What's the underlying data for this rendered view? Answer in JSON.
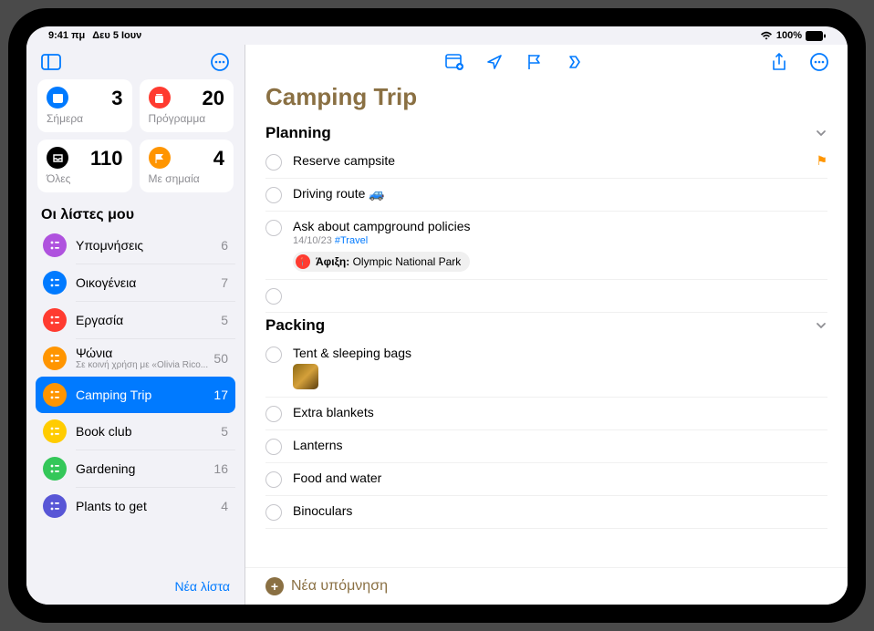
{
  "status": {
    "time": "9:41 πμ",
    "date": "Δευ 5 Ιουν",
    "battery": "100%"
  },
  "smartLists": [
    {
      "label": "Σήμερα",
      "count": "3",
      "color": "#007aff",
      "icon": "calendar"
    },
    {
      "label": "Πρόγραμμα",
      "count": "20",
      "color": "#ff3b30",
      "icon": "calendar-stack"
    },
    {
      "label": "Όλες",
      "count": "110",
      "color": "#000",
      "icon": "tray"
    },
    {
      "label": "Με σημαία",
      "count": "4",
      "color": "#ff9500",
      "icon": "flag"
    }
  ],
  "myListsHeader": "Οι λίστες μου",
  "lists": [
    {
      "name": "Υπομνήσεις",
      "count": "6",
      "color": "#af52de",
      "sub": ""
    },
    {
      "name": "Οικογένεια",
      "count": "7",
      "color": "#007aff",
      "sub": ""
    },
    {
      "name": "Εργασία",
      "count": "5",
      "color": "#ff3b30",
      "sub": ""
    },
    {
      "name": "Ψώνια",
      "count": "50",
      "color": "#ff9500",
      "sub": "Σε κοινή χρήση με «Olivia Rico..."
    },
    {
      "name": "Camping Trip",
      "count": "17",
      "color": "#ff9500",
      "sub": "",
      "selected": true
    },
    {
      "name": "Book club",
      "count": "5",
      "color": "#ffcc00",
      "sub": ""
    },
    {
      "name": "Gardening",
      "count": "16",
      "color": "#34c759",
      "sub": ""
    },
    {
      "name": "Plants to get",
      "count": "4",
      "color": "#5856d6",
      "sub": ""
    }
  ],
  "newListLabel": "Νέα λίστα",
  "main": {
    "title": "Camping Trip",
    "titleColor": "#8a7043",
    "sections": [
      {
        "name": "Planning",
        "items": [
          {
            "title": "Reserve campsite",
            "flagged": true
          },
          {
            "title": "Driving route 🚙"
          },
          {
            "title": "Ask about campground policies",
            "date": "14/10/23",
            "tag": "#Travel",
            "locationLabel": "Άφιξη:",
            "locationPlace": "Olympic National Park"
          },
          {
            "title": ""
          }
        ]
      },
      {
        "name": "Packing",
        "items": [
          {
            "title": "Tent & sleeping bags",
            "thumb": true
          },
          {
            "title": "Extra blankets"
          },
          {
            "title": "Lanterns"
          },
          {
            "title": "Food and water"
          },
          {
            "title": "Binoculars"
          }
        ]
      }
    ],
    "newReminderLabel": "Νέα υπόμνηση"
  }
}
